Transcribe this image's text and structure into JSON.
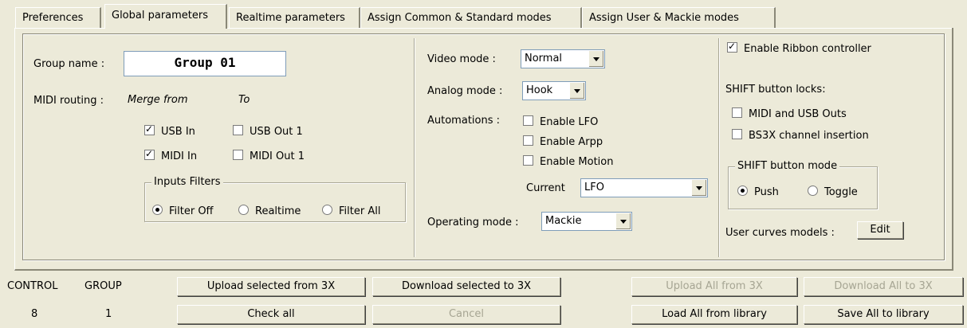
{
  "tabs": [
    "Preferences",
    "Global parameters",
    "Realtime parameters",
    "Assign Common & Standard modes",
    "Assign User & Mackie modes"
  ],
  "left": {
    "group_name_label": "Group name :",
    "group_name_value": "Group 01",
    "midi_routing_label": "MIDI routing :",
    "merge_from": "Merge from",
    "to": "To",
    "usb_in": "USB In",
    "usb_out": "USB Out 1",
    "midi_in": "MIDI In",
    "midi_out": "MIDI Out 1",
    "inputs_filters_title": "Inputs Filters",
    "filter_off": "Filter Off",
    "realtime": "Realtime",
    "filter_all": "Filter All"
  },
  "middle": {
    "video_mode_label": "Video mode :",
    "video_mode_value": "Normal",
    "analog_mode_label": "Analog mode :",
    "analog_mode_value": "Hook",
    "automations_label": "Automations :",
    "enable_lfo": "Enable LFO",
    "enable_arpp": "Enable Arpp",
    "enable_motion": "Enable Motion",
    "current_label": "Current",
    "current_value": "LFO",
    "operating_mode_label": "Operating mode :",
    "operating_mode_value": "Mackie"
  },
  "right": {
    "enable_ribbon": "Enable Ribbon controller",
    "shift_locks_label": "SHIFT button locks:",
    "midi_usb_outs": "MIDI and USB Outs",
    "bs3x_insertion": "BS3X channel insertion",
    "shift_mode_title": "SHIFT button mode",
    "push": "Push",
    "toggle": "Toggle",
    "user_curves_label": "User curves models :",
    "edit_button": "Edit"
  },
  "bottom": {
    "control_label": "CONTROL",
    "group_label": "GROUP",
    "control_value": "8",
    "group_value": "1",
    "upload_selected": "Upload selected from 3X",
    "download_selected": "Download selected to 3X",
    "upload_all": "Upload All from 3X",
    "download_all": "Download All to 3X",
    "check_all": "Check all",
    "cancel": "Cancel",
    "load_all": "Load All from library",
    "save_all": "Save All to library"
  }
}
